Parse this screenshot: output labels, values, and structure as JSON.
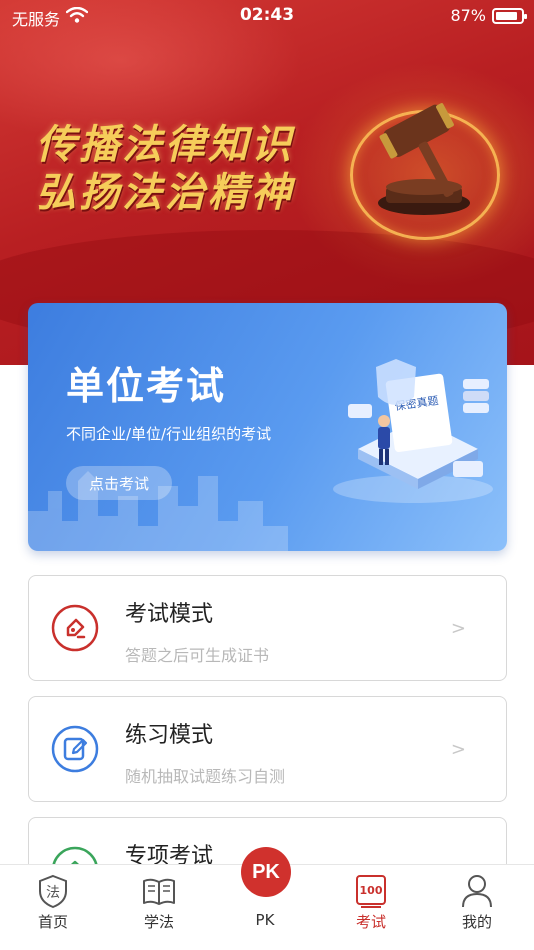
{
  "status_bar": {
    "carrier": "无服务",
    "time": "02:43",
    "battery_percent": "87%",
    "battery_level": 0.87
  },
  "banner": {
    "line1": "传播法律知识",
    "line2": "弘扬法治精神"
  },
  "exam_card": {
    "title": "单位考试",
    "subtitle": "不同企业/单位/行业组织的考试",
    "button_label": "点击考试",
    "illustration_label": "保密真题"
  },
  "modes": [
    {
      "title": "考试模式",
      "desc": "答题之后可生成证书",
      "arrow": ">"
    },
    {
      "title": "练习模式",
      "desc": "随机抽取试题练习自测",
      "arrow": ">"
    },
    {
      "title": "专项考试",
      "desc": "",
      "arrow": ""
    }
  ],
  "tabs": [
    {
      "label": "首页",
      "icon": "law-shield-icon",
      "icon_text": "法"
    },
    {
      "label": "学法",
      "icon": "book-icon"
    },
    {
      "label": "PK",
      "icon": "pk-icon",
      "icon_text": "PK"
    },
    {
      "label": "考试",
      "icon": "exam-score-icon",
      "icon_text": "100",
      "active": true
    },
    {
      "label": "我的",
      "icon": "user-icon"
    }
  ],
  "colors": {
    "brand_red": "#c9302c",
    "hero_red": "#b81f22",
    "exam_blue": "#3d7ddf",
    "gold_text": "#f6cd5a"
  }
}
